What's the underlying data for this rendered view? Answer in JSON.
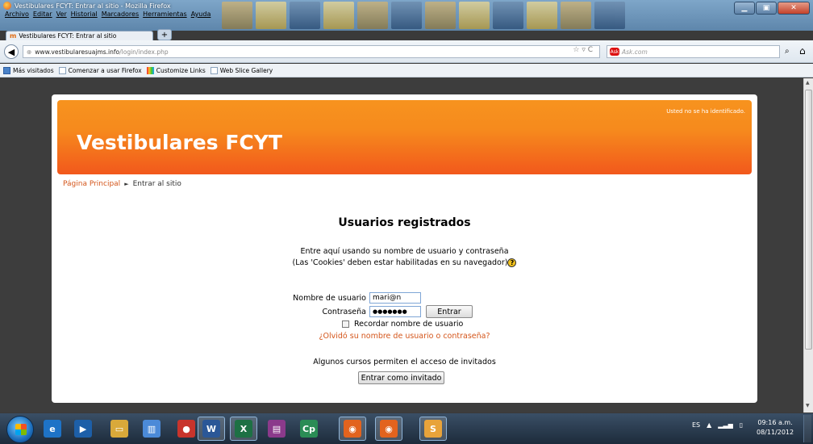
{
  "browser": {
    "window_title": "Vestibulares FCYT: Entrar al sitio - Mozilla Firefox",
    "menu": [
      "Archivo",
      "Editar",
      "Ver",
      "Historial",
      "Marcadores",
      "Herramientas",
      "Ayuda"
    ],
    "tab_label": "Vestibulares FCYT: Entrar al sitio",
    "tab_icon_letter": "m",
    "new_tab": "+",
    "url_host": "www.vestibularesuajms.info",
    "url_path": "/login/index.php",
    "url_buttons": "☆ ▿ C",
    "search_placeholder": "Ask.com",
    "search_engine_logo": "Ask",
    "bookmarks": [
      "Más visitados",
      "Comenzar a usar Firefox",
      "Customize Links",
      "Web Slice Gallery"
    ]
  },
  "page": {
    "login_info": "Usted no se ha identificado.",
    "site_title": "Vestibulares FCYT",
    "breadcrumb": {
      "home": "Página Principal",
      "separator": "►",
      "current": "Entrar al sitio"
    },
    "section_title": "Usuarios registrados",
    "intro_line1": "Entre aquí usando su nombre de usuario y contraseña",
    "intro_line2": "(Las 'Cookies' deben estar habilitadas en su navegador)",
    "help_glyph": "?",
    "username_label": "Nombre de usuario",
    "username_value": "mari@n",
    "password_label": "Contraseña",
    "password_value": "●●●●●●●",
    "login_button": "Entrar",
    "remember_label": "Recordar nombre de usuario",
    "forgot_link": "¿Olvidó su nombre de usuario o contraseña?",
    "guests_text": "Algunos cursos permiten el acceso de invitados",
    "guest_button": "Entrar como invitado"
  },
  "colors": {
    "banner_top": "#f7931e",
    "banner_bottom": "#f2581c",
    "link": "#d4551a"
  },
  "taskbar": {
    "apps": [
      {
        "name": "internet-explorer-icon",
        "glyph": "e"
      },
      {
        "name": "media-icon",
        "glyph": "▶"
      },
      {
        "name": "explorer-folder-icon",
        "glyph": "▭"
      },
      {
        "name": "app-icon",
        "glyph": "▥"
      },
      {
        "name": "red-app-icon",
        "glyph": "●"
      },
      {
        "name": "word-icon",
        "glyph": "W"
      },
      {
        "name": "excel-icon",
        "glyph": "X"
      },
      {
        "name": "winrar-icon",
        "glyph": "▤"
      },
      {
        "name": "captivate-icon",
        "glyph": "Cp"
      },
      {
        "name": "firefox-icon",
        "glyph": "◉"
      },
      {
        "name": "firefox-icon-2",
        "glyph": "◉"
      },
      {
        "name": "app-icon-2",
        "glyph": "S"
      }
    ],
    "language": "ES",
    "time": "09:16 a.m.",
    "date": "08/11/2012"
  }
}
